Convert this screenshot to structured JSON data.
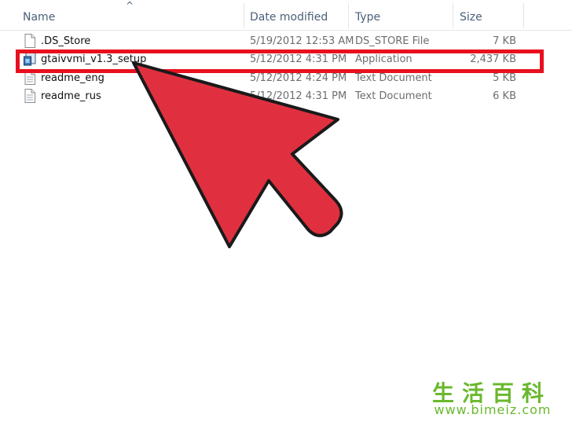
{
  "columns": {
    "name": "Name",
    "date_modified": "Date modified",
    "type": "Type",
    "size": "Size"
  },
  "files": [
    {
      "name": ".DS_Store",
      "date": "5/19/2012 12:53 AM",
      "type": "DS_STORE File",
      "size": "7 KB",
      "icon": "document-icon"
    },
    {
      "name": "gtaivvmi_v1.3_setup",
      "date": "5/12/2012 4:31 PM",
      "type": "Application",
      "size": "2,437 KB",
      "icon": "installer-icon"
    },
    {
      "name": "readme_eng",
      "date": "5/12/2012 4:24 PM",
      "type": "Text Document",
      "size": "5 KB",
      "icon": "text-file-icon"
    },
    {
      "name": "readme_rus",
      "date": "5/12/2012 4:31 PM",
      "type": "Text Document",
      "size": "6 KB",
      "icon": "text-file-icon"
    }
  ],
  "highlighted_file": "gtaivvmi_v1.3_setup",
  "colors": {
    "highlight_border": "#e8101f",
    "arrow_fill": "#e03040",
    "header_text": "#4c607a",
    "watermark": "#6ab82e"
  },
  "watermark": {
    "logo": "生活百科",
    "url": "www.bimeiz.com"
  }
}
